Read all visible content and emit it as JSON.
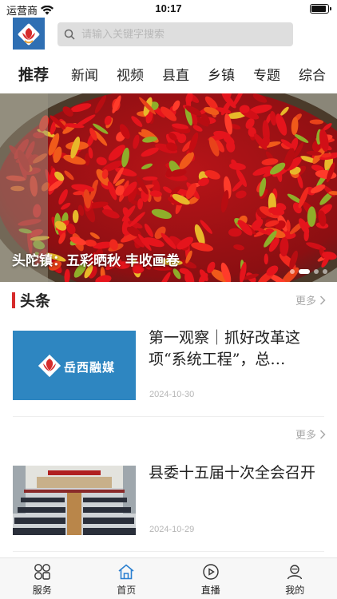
{
  "status_bar": {
    "carrier": "运营商",
    "time": "10:17",
    "battery_level": 0.9
  },
  "header": {
    "search_placeholder": "请输入关键字搜索"
  },
  "tabs": [
    "推荐",
    "新闻",
    "视频",
    "县直",
    "乡镇",
    "专题",
    "综合"
  ],
  "banner": {
    "caption": "头陀镇：五彩晒秋 丰收画卷",
    "slide_count": 5,
    "active_slide": 0
  },
  "section": {
    "title": "头条",
    "more_label": "更多"
  },
  "news": [
    {
      "title": "第一观察｜抓好改革这项“系统工程”，总…",
      "date": "2024-10-30",
      "thumb_text": "岳西融媒"
    },
    {
      "more_label": "更多",
      "title": "县委十五届十次全会召开",
      "date": "2024-10-29"
    }
  ],
  "bottom_nav": [
    {
      "label": "服务",
      "icon": "grid-icon"
    },
    {
      "label": "首页",
      "icon": "home-icon"
    },
    {
      "label": "直播",
      "icon": "live-icon"
    },
    {
      "label": "我的",
      "icon": "profile-icon"
    }
  ],
  "colors": {
    "accent_red": "#d62b2b",
    "logo_blue": "#2f6fb3",
    "active_nav": "#2a7fd0"
  }
}
